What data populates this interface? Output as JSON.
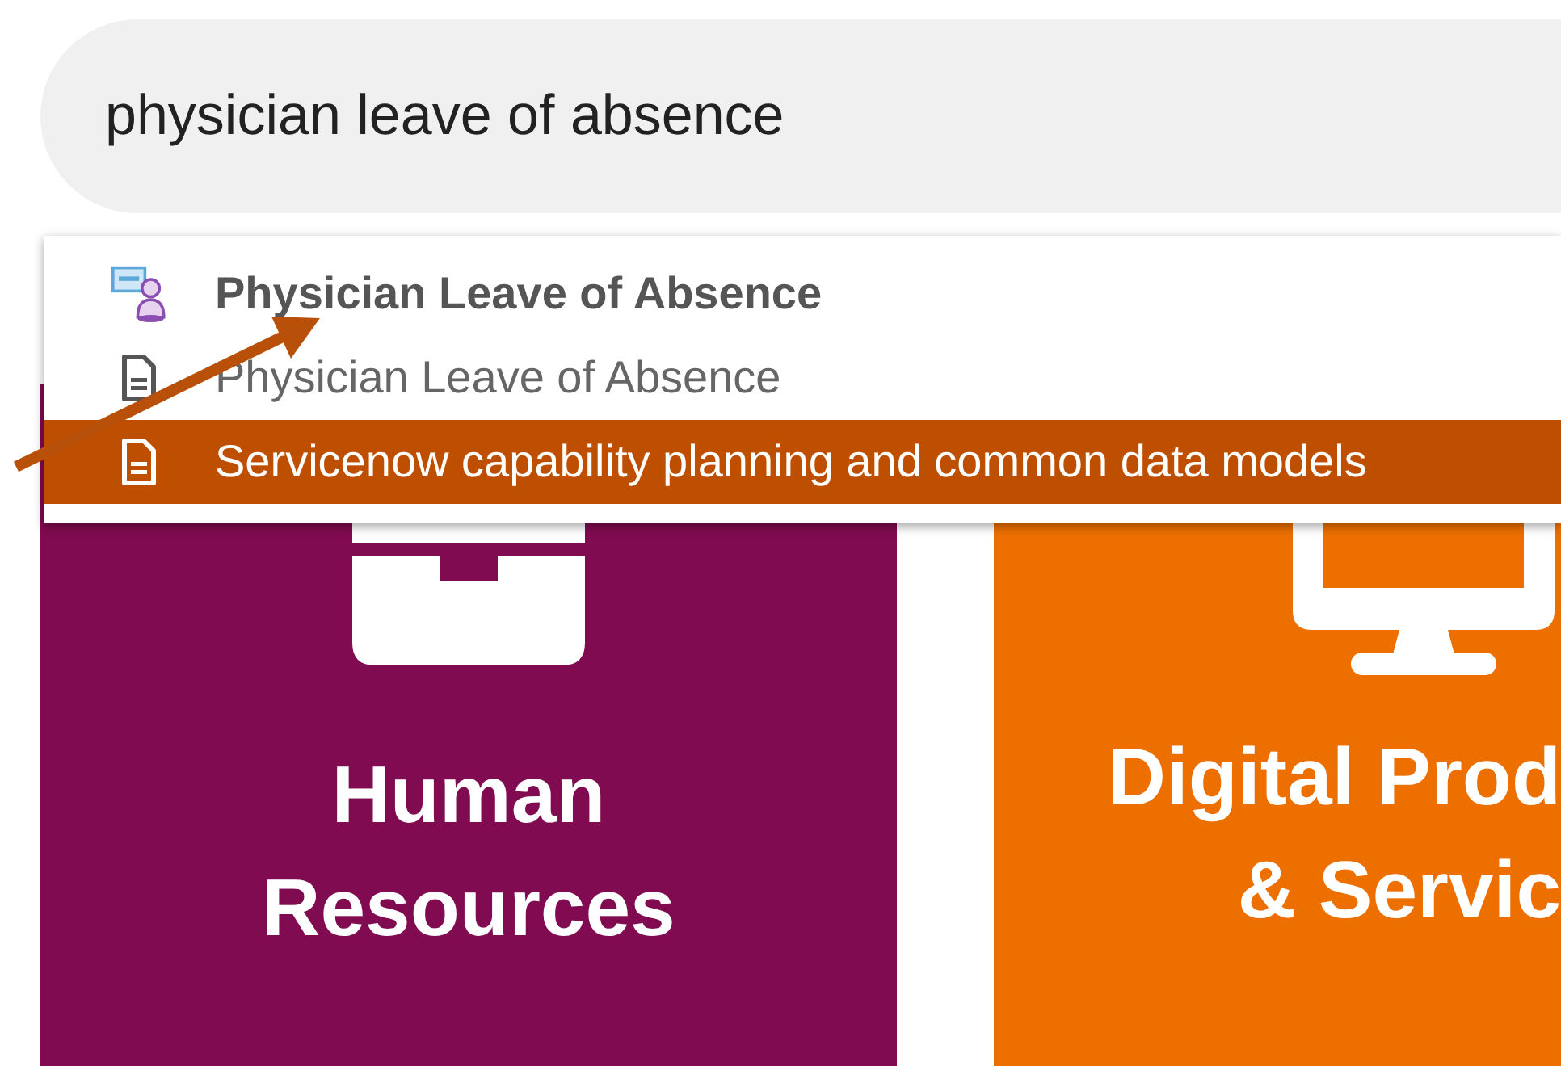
{
  "search": {
    "value": "physician leave of absence"
  },
  "suggestions": [
    {
      "kind": "record",
      "label": "Physician Leave of Absence",
      "selected": false
    },
    {
      "kind": "article",
      "label": "Physician Leave of Absence",
      "selected": false
    },
    {
      "kind": "article",
      "label": "Servicenow capability planning and common data models",
      "selected": true
    }
  ],
  "tiles": [
    {
      "kind": "briefcase",
      "color": "#800b50",
      "lines": [
        "Human",
        "Resources"
      ]
    },
    {
      "kind": "monitor",
      "color": "#ec6f00",
      "lines": [
        "Digital Prod",
        "& Servic"
      ]
    }
  ]
}
